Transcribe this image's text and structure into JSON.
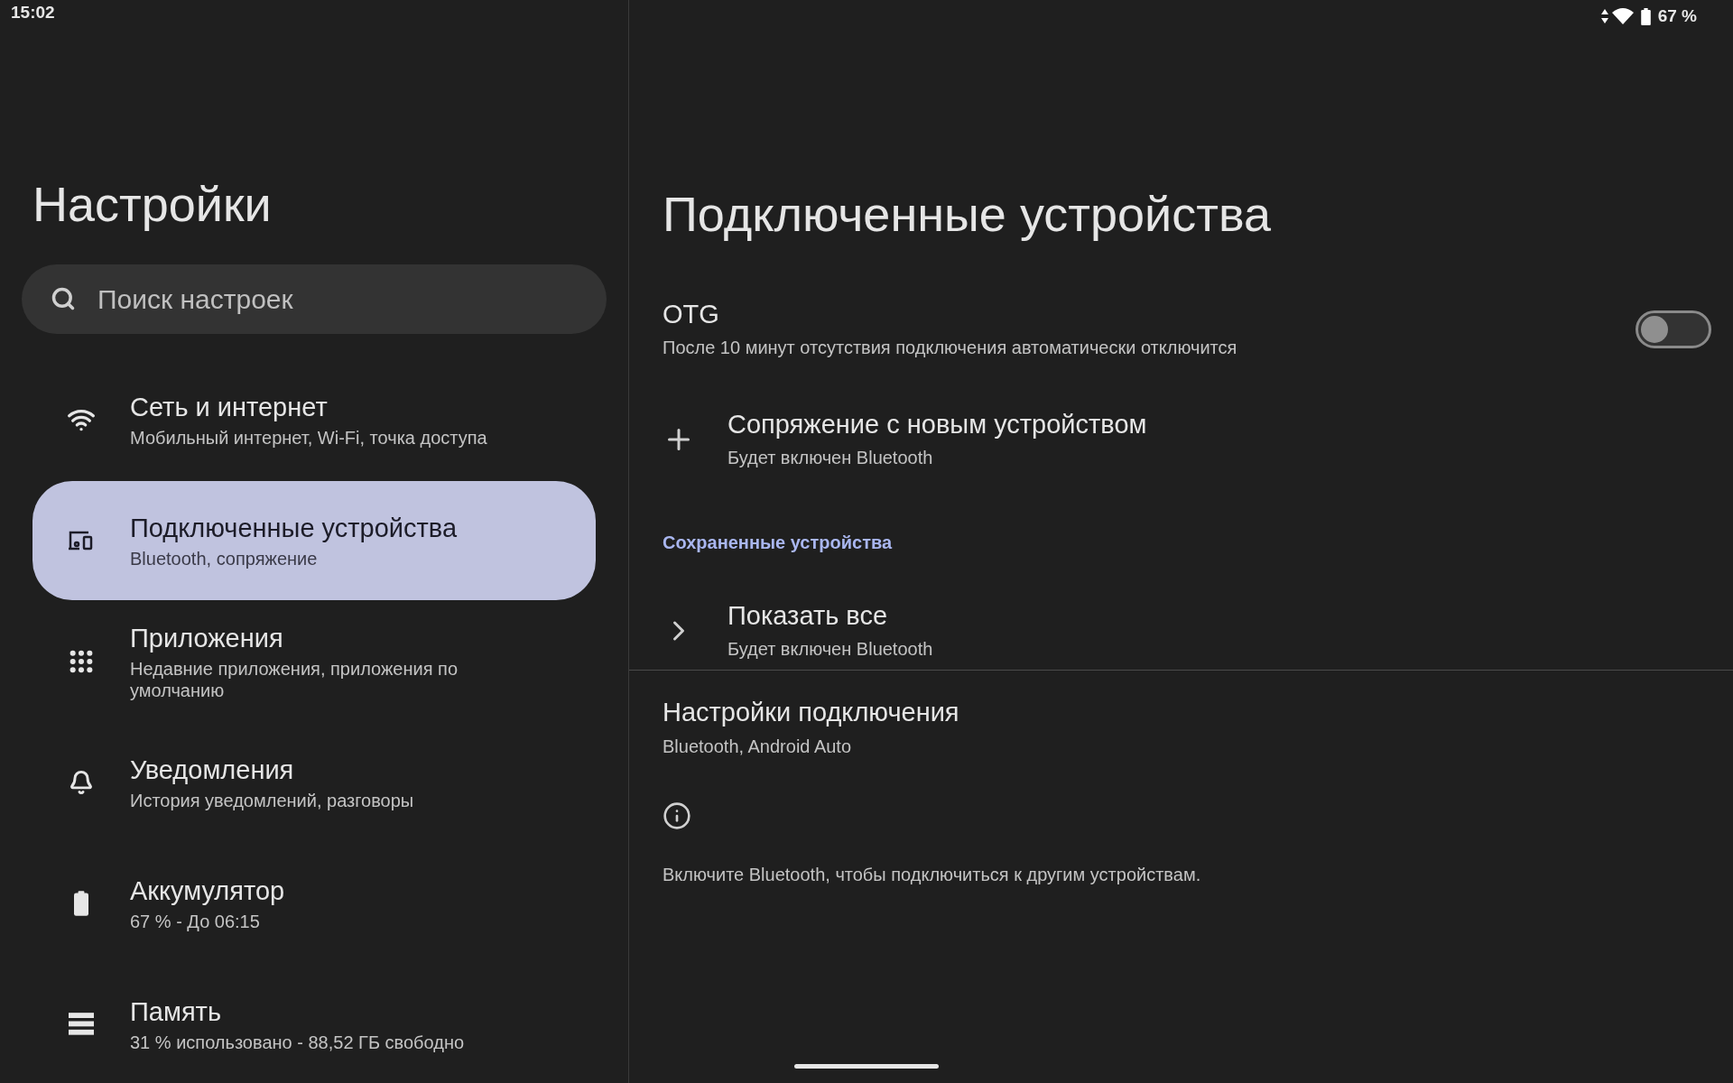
{
  "status_bar": {
    "time": "15:02",
    "battery": "67 %"
  },
  "sidebar": {
    "title": "Настройки",
    "search": {
      "placeholder": "Поиск настроек"
    },
    "items": [
      {
        "kind": "wifi",
        "title": "Сеть и интернет",
        "subtitle": "Мобильный интернет, Wi-Fi, точка доступа",
        "selected": false
      },
      {
        "kind": "devices",
        "title": "Подключенные устройства",
        "subtitle": "Bluetooth, сопряжение",
        "selected": true
      },
      {
        "kind": "apps",
        "title": "Приложения",
        "subtitle": "Недавние приложения, приложения по умолчанию",
        "selected": false
      },
      {
        "kind": "bell",
        "title": "Уведомления",
        "subtitle": "История уведомлений, разговоры",
        "selected": false
      },
      {
        "kind": "battery",
        "title": "Аккумулятор",
        "subtitle": "67 % - До 06:15",
        "selected": false
      },
      {
        "kind": "storage",
        "title": "Память",
        "subtitle": "31 % использовано - 88,52 ГБ свободно",
        "selected": false
      }
    ]
  },
  "page": {
    "title": "Подключенные устройства",
    "otg": {
      "title": "OTG",
      "subtitle": "После 10 минут отсутствия подключения автоматически отключится",
      "on": false
    },
    "pair": {
      "title": "Сопряжение с новым устройством",
      "subtitle": "Будет включен Bluetooth"
    },
    "saved_header": "Сохраненные устройства",
    "show_all": {
      "title": "Показать все",
      "subtitle": "Будет включен Bluetooth"
    },
    "connection": {
      "title": "Настройки подключения",
      "subtitle": "Bluetooth, Android Auto"
    },
    "info": "Включите Bluetooth, чтобы подключиться к другим устройствам."
  }
}
